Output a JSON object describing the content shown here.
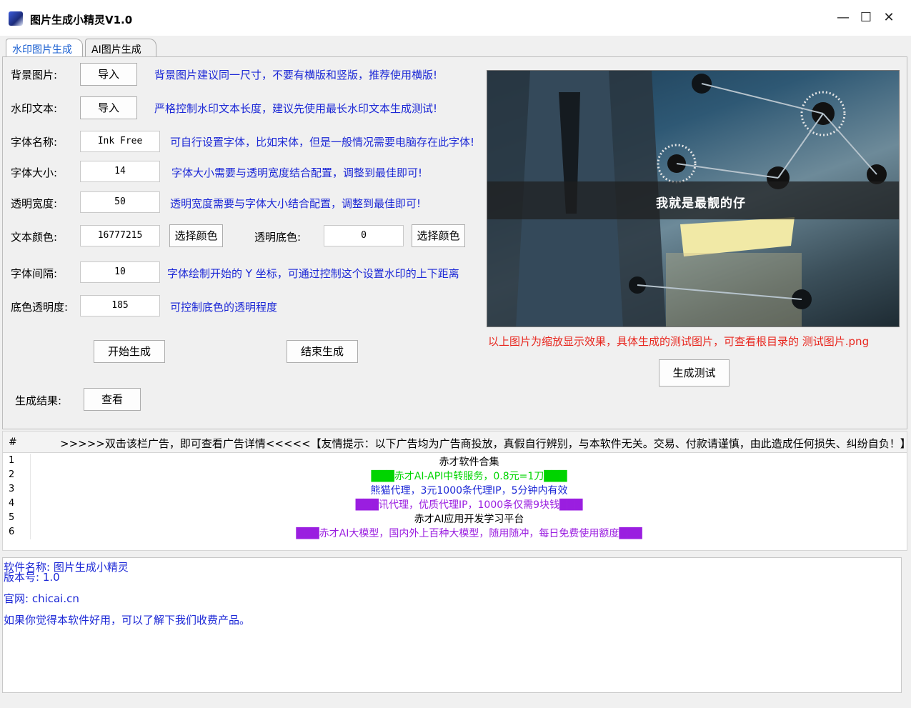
{
  "window": {
    "title": "图片生成小精灵V1.0",
    "controls": {
      "minimize": "—",
      "maximize": "☐",
      "close": "✕"
    }
  },
  "tabs": [
    {
      "label": "水印图片生成",
      "active": true
    },
    {
      "label": "AI图片生成",
      "active": false
    }
  ],
  "form": {
    "background": {
      "label": "背景图片:",
      "button": "导入",
      "hint": "背景图片建议同一尺寸，不要有横版和竖版，推荐使用横版!"
    },
    "watermark_text": {
      "label": "水印文本:",
      "button": "导入",
      "hint": "严格控制水印文本长度，建议先使用最长水印文本生成测试!"
    },
    "font_name": {
      "label": "字体名称:",
      "value": "Ink Free",
      "hint": "可自行设置字体，比如宋体，但是一般情况需要电脑存在此字体!"
    },
    "font_size": {
      "label": "字体大小:",
      "value": "14",
      "hint": "字体大小需要与透明宽度结合配置，调整到最佳即可!"
    },
    "transparent_width": {
      "label": "透明宽度:",
      "value": "50",
      "hint": "透明宽度需要与字体大小结合配置，调整到最佳即可!"
    },
    "text_color": {
      "label": "文本颜色:",
      "value": "16777215",
      "button": "选择颜色"
    },
    "transparent_bg": {
      "label": "透明底色:",
      "value": "0",
      "button": "选择颜色"
    },
    "font_spacing": {
      "label": "字体间隔:",
      "value": "10",
      "hint": "字体绘制开始的 Y 坐标，可通过控制这个设置水印的上下距离"
    },
    "bg_opacity": {
      "label": "底色透明度:",
      "value": "185",
      "hint": "可控制底色的透明程度"
    },
    "start_button": "开始生成",
    "stop_button": "结束生成",
    "result": {
      "label": "生成结果:",
      "button": "查看"
    }
  },
  "preview": {
    "overlay_text": "我就是最靓的仔",
    "note": "以上图片为缩放显示效果，具体生成的测试图片，可查看根目录的  测试图片.png",
    "test_button": "生成测试"
  },
  "ads": {
    "header_hash": "#",
    "header_text": ">>>>>双击该栏广告，即可查看广告详情<<<<<【友情提示：以下广告均为广告商投放，真假自行辨别，与本软件无关。交易、付款请谨慎，由此造成任何损失、纠纷自负！】",
    "rows": [
      {
        "num": "1",
        "text": "赤才软件合集",
        "color": "#000000"
      },
      {
        "num": "2",
        "text": "███赤才AI-API中转服务，0.8元=1刀███",
        "color": "#00d400"
      },
      {
        "num": "3",
        "text": "熊猫代理，3元1000条代理IP，5分钟内有效",
        "color": "#1c28d6"
      },
      {
        "num": "4",
        "text": "███讯代理，优质代理IP，1000条仅需9块钱███",
        "color": "#9a1ee0"
      },
      {
        "num": "5",
        "text": "赤才AI应用开发学习平台",
        "color": "#000000"
      },
      {
        "num": "6",
        "text": "███赤才AI大模型，国内外上百种大模型，随用随冲，每日免费使用额度███",
        "color": "#9a1ee0"
      }
    ]
  },
  "info": {
    "line1": "软件名称: 图片生成小精灵",
    "line2": "版本号: 1.0",
    "line3": "官网: chicai.cn",
    "line4": "如果你觉得本软件好用，可以了解下我们收费产品。"
  },
  "colors": {
    "accent_blue": "#1c28d6",
    "warning_red": "#e8261e",
    "ad_green": "#00d400",
    "ad_purple": "#9a1ee0"
  }
}
